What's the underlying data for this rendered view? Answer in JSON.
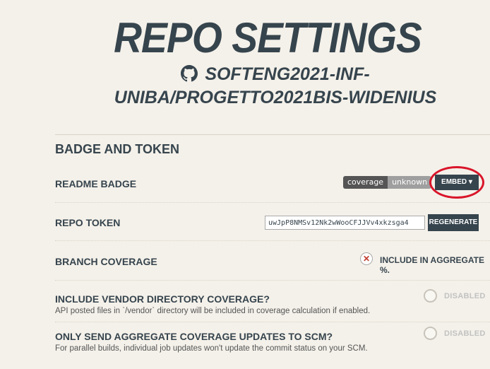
{
  "header": {
    "title": "REPO SETTINGS",
    "repo_name": "SOFTENG2021-INF-UNIBA/PROGETTO2021BIS-WIDENIUS"
  },
  "section": {
    "title": "BADGE AND TOKEN",
    "readme_badge": {
      "label": "README BADGE",
      "badge_left": "coverage",
      "badge_right": "unknown",
      "embed_button": "EMBED ▾"
    },
    "repo_token": {
      "label": "REPO TOKEN",
      "value": "uwJpP8NMSv12Nk2wWooCFJJVv4xkzsga4",
      "regenerate_button": "REGENERATE"
    },
    "branch_coverage": {
      "label": "BRANCH COVERAGE",
      "option_label": "INCLUDE IN AGGREGATE %."
    },
    "vendor_coverage": {
      "label": "INCLUDE VENDOR DIRECTORY COVERAGE?",
      "description": "API posted files in `/vendor` directory will be included in coverage calculation if enabled.",
      "state": "DISABLED"
    },
    "aggregate_only": {
      "label": "ONLY SEND AGGREGATE COVERAGE UPDATES TO SCM?",
      "description": "For parallel builds, individual job updates won't update the commit status on your SCM.",
      "state": "DISABLED"
    }
  },
  "colors": {
    "background": "#f4f1ea",
    "text": "#36444d",
    "highlight": "#d9152a"
  }
}
